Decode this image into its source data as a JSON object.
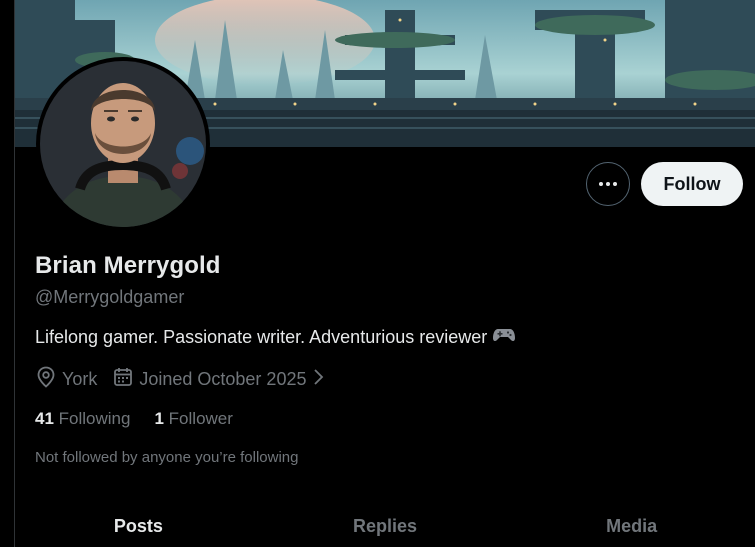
{
  "profile": {
    "display_name": "Brian Merrygold",
    "handle": "@Merrygoldgamer",
    "bio": "Lifelong gamer. Passionate writer. Adventurious reviewer",
    "location": "York",
    "joined": "Joined October 2025",
    "following_count": "41",
    "following_label": "Following",
    "followers_count": "1",
    "followers_label": "Follower",
    "followed_note": "Not followed by anyone you’re following"
  },
  "actions": {
    "follow_label": "Follow",
    "more_icon": "more-horizontal-icon"
  },
  "tabs": [
    {
      "label": "Posts",
      "active": true
    },
    {
      "label": "Replies",
      "active": false
    },
    {
      "label": "Media",
      "active": false
    }
  ],
  "colors": {
    "background": "#000000",
    "primary_text": "#e7e9ea",
    "secondary_text": "#71767b",
    "follow_button_bg": "#eff3f4",
    "border": "#536471"
  },
  "icons": {
    "location": "location-pin-icon",
    "calendar": "calendar-icon",
    "chevron": "chevron-right-icon",
    "bio_emoji": "gamepad-icon"
  }
}
